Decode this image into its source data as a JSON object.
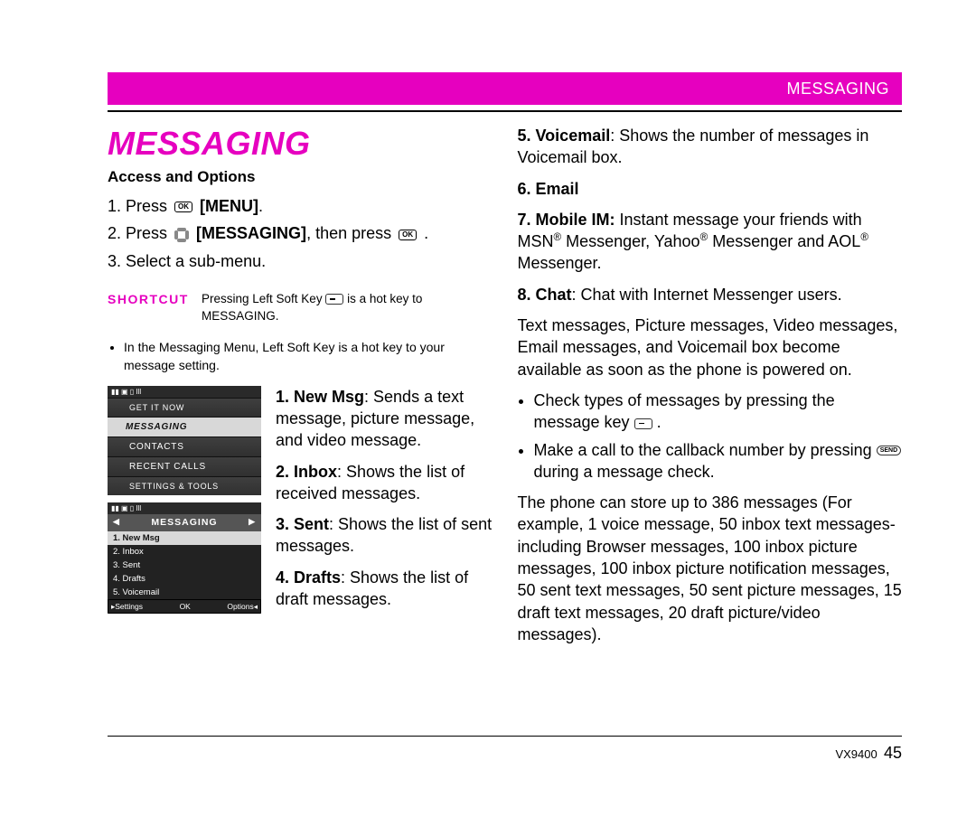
{
  "header": {
    "title": "MESSAGING"
  },
  "left": {
    "section_title": "MESSAGING",
    "subhead": "Access and Options",
    "steps": {
      "s1_pre": "1. Press ",
      "s1_post": " [MENU].",
      "s1_menu_bold": "[MENU]",
      "s2_pre": "2. Press ",
      "s2_mid_bold": "[MESSAGING]",
      "s2_mid_after": ", then press ",
      "s2_end": " .",
      "s3": "3. Select a sub-menu."
    },
    "shortcut": {
      "label": "SHORTCUT",
      "text_a": "Pressing Left Soft Key ",
      "text_b": " is a hot key to MESSAGING."
    },
    "bullet": "In the Messaging Menu, Left Soft Key is a hot key to your message setting.",
    "phone1": {
      "getit": "GET IT NOW",
      "messaging": "MESSAGING",
      "contacts": "CONTACTS",
      "recent": "RECENT CALLS",
      "settings": "SETTINGS & TOOLS"
    },
    "phone2": {
      "hdr": "MESSAGING",
      "r1": "1. New Msg",
      "r2": "2. Inbox",
      "r3": "3. Sent",
      "r4": "4. Drafts",
      "r5": "5. Voicemail",
      "soft_l": "▸Settings",
      "soft_c": "OK",
      "soft_r": "Options◂"
    },
    "side_items": {
      "i1_b": "1. New Msg",
      "i1_t": ": Sends a text message, picture message, and video message.",
      "i2_b": "2. Inbox",
      "i2_t": ": Shows the list of received messages.",
      "i3_b": "3. Sent",
      "i3_t": ": Shows the list of sent messages.",
      "i4_b": "4. Drafts",
      "i4_t": ": Shows the list of draft messages."
    }
  },
  "right": {
    "i5_b": "5. Voicemail",
    "i5_t": ": Shows the number of messages in Voicemail box.",
    "i6_b": "6. Email",
    "i7_b": "7. Mobile IM:",
    "i7_t_a": " Instant message your friends with MSN",
    "i7_t_b": " Messenger, Yahoo",
    "i7_t_c": " Messenger and AOL",
    "i7_t_d": " Messenger.",
    "i8_b": "8. Chat",
    "i8_t": ": Chat with Internet Messenger users.",
    "para1": "Text messages, Picture messages, Video messages, Email messages, and Voicemail box become available as soon as the phone is powered on.",
    "b1a": "Check types of messages by pressing the message key ",
    "b1b": " .",
    "b2a": "Make a call to the callback number by pressing ",
    "b2b": " during a message check.",
    "para2": "The phone can store up to 386 messages (For example, 1 voice message, 50 inbox text messages- including Browser messages, 100 inbox picture messages, 100 inbox picture notification messages, 50 sent text messages, 50 sent picture messages, 15 draft text messages, 20 draft picture/video messages)."
  },
  "footer": {
    "model": "VX9400",
    "page": "45"
  }
}
